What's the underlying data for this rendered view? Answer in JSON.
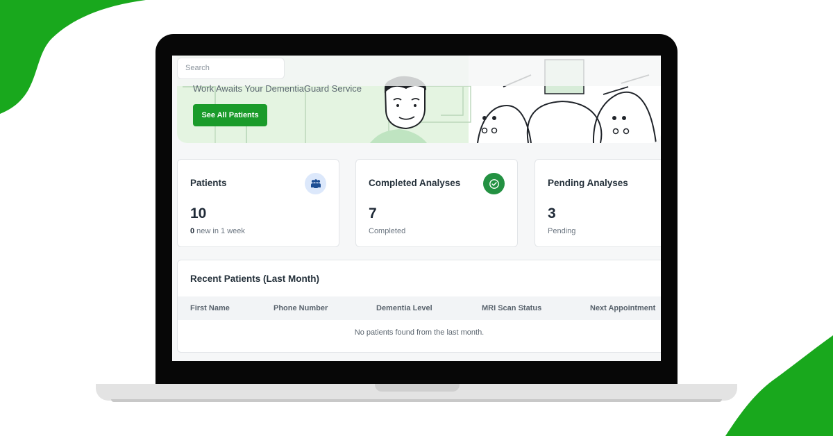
{
  "search": {
    "placeholder": "Search"
  },
  "hero": {
    "message": "Work Awaits Your DementiaGuard Service",
    "button_label": "See All Patients"
  },
  "stats": [
    {
      "title": "Patients",
      "value": "10",
      "sub_count": "0",
      "sub_text": " new in 1 week",
      "icon": "users-icon"
    },
    {
      "title": "Completed Analyses",
      "value": "7",
      "sub_text": "Completed",
      "icon": "check-circle-icon"
    },
    {
      "title": "Pending Analyses",
      "value": "3",
      "sub_text": "Pending",
      "icon": "none"
    }
  ],
  "recent": {
    "title": "Recent Patients (Last Month)",
    "columns": [
      "First Name",
      "Phone Number",
      "Dementia Level",
      "MRI Scan Status",
      "Next Appointment"
    ],
    "empty_message": "No patients found from the last month."
  },
  "colors": {
    "accent": "#1a9b2a",
    "decoration_green": "#19a81d",
    "hero_green": "#e4f4e1",
    "completed_icon_bg": "#239142",
    "patients_icon_bg": "#dce8fb"
  }
}
